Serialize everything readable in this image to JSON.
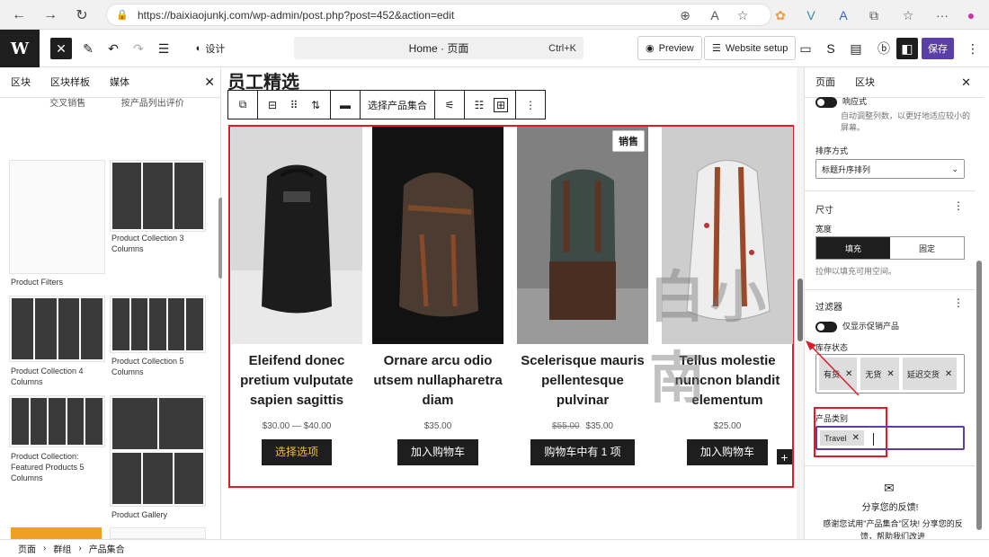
{
  "browser": {
    "url": "https://baixiaojunkj.com/wp-admin/post.php?post=452&action=edit"
  },
  "toolbar": {
    "logo": "W",
    "document_title": "Home · 页面",
    "shortcut": "Ctrl+K",
    "design_label": "设计",
    "preview_label": "Preview",
    "website_setup_label": "Website setup",
    "save_label": "保存"
  },
  "left_panel": {
    "tabs": [
      "区块",
      "区块样板",
      "媒体"
    ],
    "sub_items": [
      "交叉销售",
      "按产品列出评价"
    ],
    "patterns": [
      "Product Filters",
      "Product Collection 3 Columns",
      "Product Collection 4 Columns",
      "Product Collection 5 Columns",
      "Product Collection: Featured Products 5 Columns",
      "Product Gallery"
    ]
  },
  "canvas": {
    "heading": "员工精选",
    "block_toolbar_label": "选择产品集合",
    "watermark": "白小南",
    "products": [
      {
        "title": "Eleifend donec pretium vulputate sapien sagittis",
        "price": "$30.00 — $40.00",
        "old_price": "",
        "button": "选择选项",
        "sale": "",
        "img_bg": "#d8d8d8",
        "bag": "#1a1a1a"
      },
      {
        "title": "Ornare arcu odio utsem nullapharetra diam",
        "price": "$35.00",
        "old_price": "",
        "button": "加入购物车",
        "sale": "",
        "img_bg": "#141414",
        "bag": "#4a3a30"
      },
      {
        "title": "Scelerisque mauris pellentesque pulvinar",
        "price": "$35.00",
        "old_price": "$55.00",
        "button": "购物车中有 1 项",
        "sale": "销售",
        "img_bg": "#7a7a7a",
        "bag": "#3d4a45"
      },
      {
        "title": "Tellus molestie nuncnon blandit elementum",
        "price": "$25.00",
        "old_price": "",
        "button": "加入购物车",
        "sale": "",
        "img_bg": "#cfcfcf",
        "bag": "#e8e8e8"
      }
    ]
  },
  "right_panel": {
    "tabs": [
      "页面",
      "区块"
    ],
    "responsive_label": "响应式",
    "responsive_help": "自动调整列数，以更好地适应较小的屏幕。",
    "order_label": "排序方式",
    "order_value": "标题升序排列",
    "size_heading": "尺寸",
    "width_label": "宽度",
    "width_options": [
      "填充",
      "固定"
    ],
    "width_help": "拉伸以填充可用空间。",
    "filter_heading": "过滤器",
    "sale_only_label": "仅显示促销产品",
    "stock_label": "库存状态",
    "stock_tokens": [
      "有货",
      "无货",
      "延迟交货"
    ],
    "category_label": "产品类别",
    "category_tokens": [
      "Travel"
    ],
    "feedback_title": "分享您的反馈!",
    "feedback_body": "感谢您试用\"产品集合\"区块! 分享您的反馈，帮助我们改进"
  },
  "breadcrumb": [
    "页面",
    "群组",
    "产品集合"
  ]
}
